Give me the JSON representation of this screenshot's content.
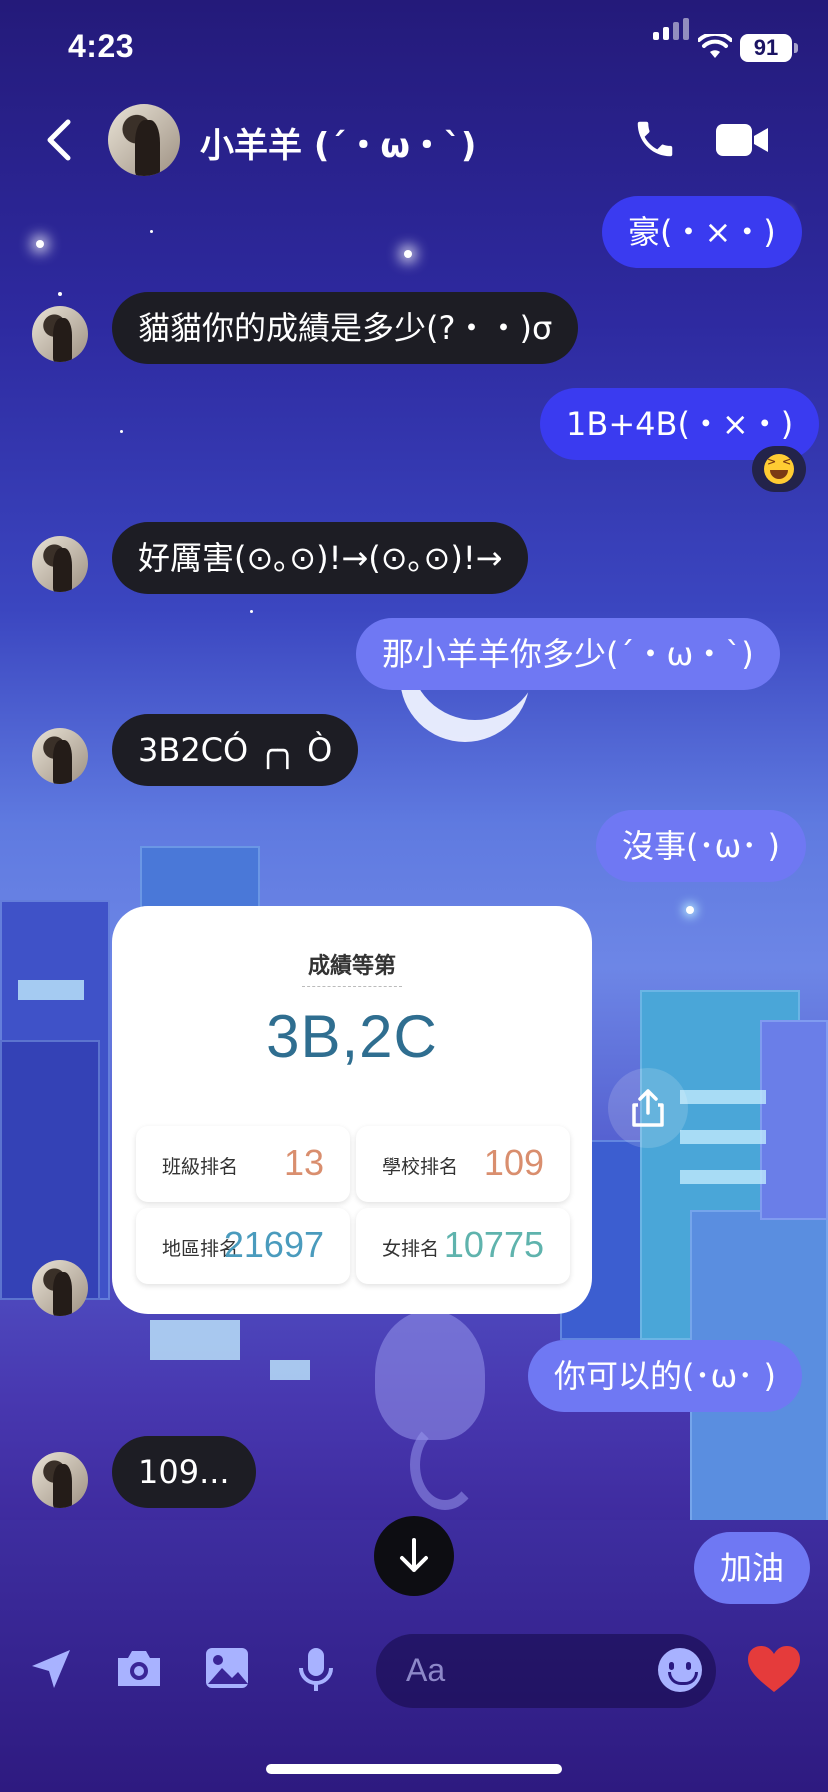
{
  "status": {
    "time": "4:23",
    "battery": "91"
  },
  "header": {
    "contact_name": "小羊羊 (´・ω・`)"
  },
  "messages": [
    {
      "dir": "out",
      "text": "豪(・×・)"
    },
    {
      "dir": "in",
      "text": "貓貓你的成績是多少(?・・)σ"
    },
    {
      "dir": "out",
      "text": "1B+4B(・×・)"
    },
    {
      "dir": "in",
      "text": "好厲害(⊙｡⊙)!→(⊙｡⊙)!→"
    },
    {
      "dir": "out",
      "text": "那小羊羊你多少(´・ω・`)"
    },
    {
      "dir": "in",
      "text": "3B2CÓ ╭╮ Ò"
    },
    {
      "dir": "out",
      "text": "沒事(･ω･ )"
    },
    {
      "dir": "out",
      "text": "你可以的(･ω･ )"
    },
    {
      "dir": "in",
      "text": "109..."
    },
    {
      "dir": "out",
      "text": "加油"
    }
  ],
  "reaction": {
    "icon": "laughing-emoji-icon"
  },
  "grade_card": {
    "title": "成績等第",
    "grade": "3B,2C",
    "ranks": [
      {
        "label": "班級排名",
        "value": "13",
        "color": "#d98e6e"
      },
      {
        "label": "學校排名",
        "value": "109",
        "color": "#d98e6e"
      },
      {
        "label": "地區排名",
        "value": "21697",
        "color": "#4a9bbd"
      },
      {
        "label": "女排名",
        "value": "10775",
        "color": "#5fb3ad"
      }
    ]
  },
  "composer": {
    "placeholder": "Aa"
  },
  "colors": {
    "outgoing": "#3a3bf0",
    "incoming": "#1d1d24",
    "heart": "#e53b3b"
  }
}
